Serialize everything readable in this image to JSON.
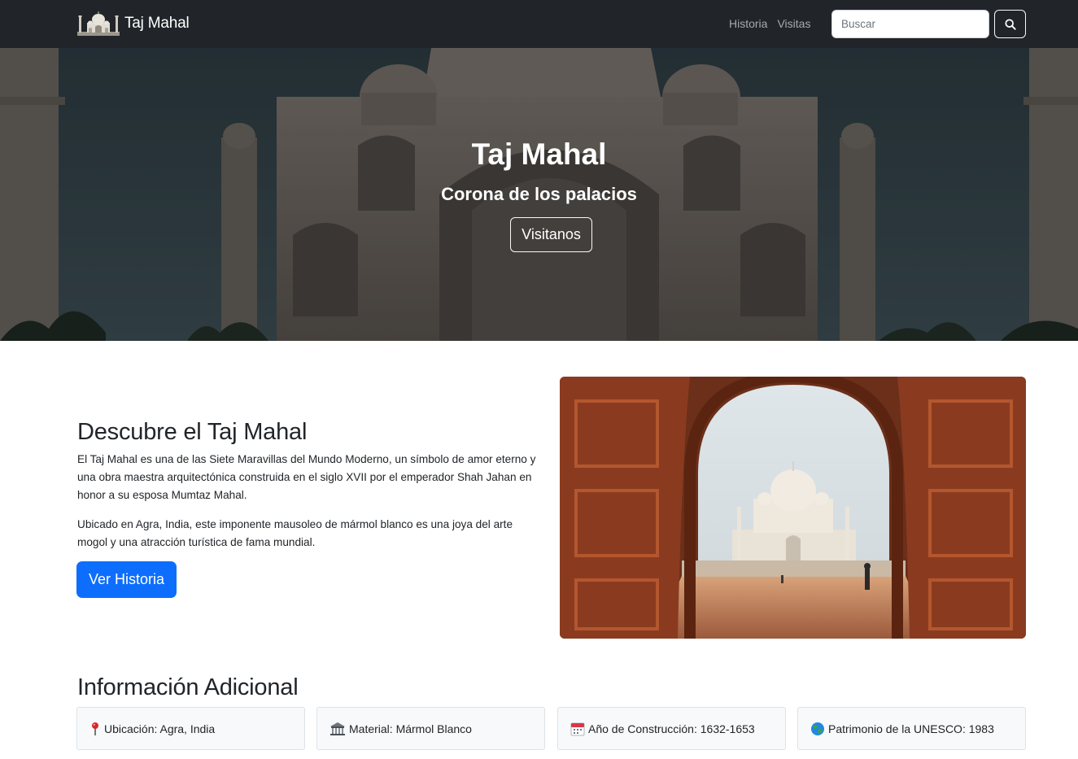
{
  "navbar": {
    "brand": "Taj Mahal",
    "links": [
      "Historia",
      "Visitas"
    ],
    "search_placeholder": "Buscar",
    "search_icon": "search-icon",
    "background": "#212529"
  },
  "hero": {
    "title": "Taj Mahal",
    "subtitle": "Corona de los palacios",
    "button": "Visitanos"
  },
  "discover": {
    "title": "Descubre el Taj Mahal",
    "paragraphs": [
      "El Taj Mahal es una de las Siete Maravillas del Mundo Moderno, un símbolo de amor eterno y una obra maestra arquitectónica construida en el siglo XVII por el emperador Shah Jahan en honor a su esposa Mumtaz Mahal.",
      "Ubicado en Agra, India, este imponente mausoleo de mármol blanco es una joya del arte mogol y una atracción turística de fama mundial."
    ],
    "button": "Ver Historia",
    "button_color": "#0d6efd"
  },
  "info": {
    "title": "Información Adicional",
    "cards": [
      {
        "icon": "pin-icon",
        "text": "Ubicación: Agra, India"
      },
      {
        "icon": "museum-icon",
        "text": "Material: Mármol Blanco"
      },
      {
        "icon": "calendar-icon",
        "text": "Año de Construcción: 1632-1653"
      },
      {
        "icon": "globe-icon",
        "text": "Patrimonio de la UNESCO: 1983"
      }
    ]
  }
}
